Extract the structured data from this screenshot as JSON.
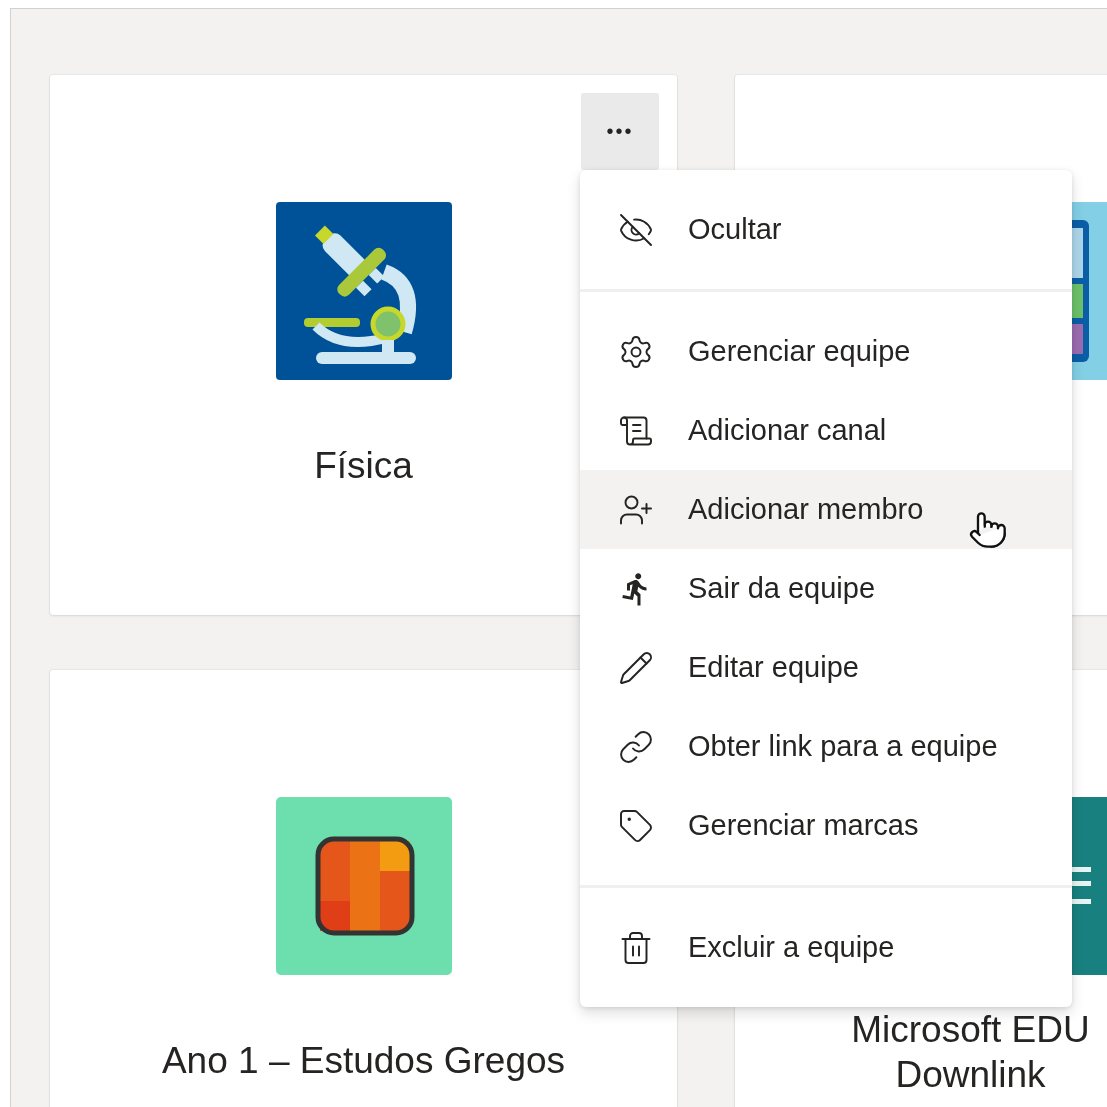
{
  "cards": [
    {
      "title_lines": [
        "Física"
      ],
      "kind": "microscope",
      "more_button": {
        "label": "•••",
        "hovered": true
      }
    },
    {
      "kind": "calculator"
    },
    {
      "title_lines": [
        "Ano 1 – Estudos Gregos"
      ],
      "kind": "squares"
    },
    {
      "title_lines": [
        "Microsoft EDU",
        "Downlink"
      ],
      "kind": "list"
    }
  ],
  "menu": {
    "sections": [
      {
        "items": [
          {
            "kind": "hide",
            "label": "Ocultar",
            "hovered": false
          }
        ]
      },
      {
        "items": [
          {
            "kind": "settings",
            "label": "Gerenciar equipe",
            "hovered": false
          },
          {
            "kind": "channel",
            "label": "Adicionar canal",
            "hovered": false
          },
          {
            "kind": "member",
            "label": "Adicionar membro",
            "hovered": true
          },
          {
            "kind": "leave",
            "label": "Sair da equipe",
            "hovered": false
          },
          {
            "kind": "edit",
            "label": "Editar equipe",
            "hovered": false
          },
          {
            "kind": "link",
            "label": "Obter link para a equipe",
            "hovered": false
          },
          {
            "kind": "tag",
            "label": "Gerenciar marcas",
            "hovered": false
          }
        ]
      },
      {
        "items": [
          {
            "kind": "delete",
            "label": "Excluir a equipe",
            "hovered": false
          }
        ]
      }
    ]
  }
}
